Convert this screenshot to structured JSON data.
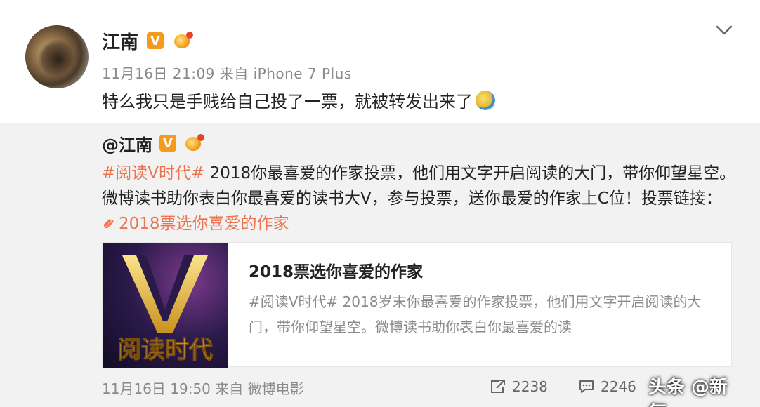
{
  "post": {
    "username": "江南",
    "v_badge": "V",
    "meta": "11月16日 21:09 来自 iPhone 7 Plus",
    "content": "特么我只是手贱给自己投了一票，就被转发出来了"
  },
  "repost": {
    "username": "@江南",
    "v_badge": "V",
    "tag": "#阅读V时代#",
    "text": " 2018你最喜爱的作家投票，他们用文字开启阅读的大门，带你仰望星空。微博读书助你表白你最喜爱的读书大V，参与投票，送你最爱的作家上C位！投票链接：",
    "link_text": "2018票选你喜爱的作家",
    "card": {
      "image_text": "阅读时代",
      "title": "2018票选你喜爱的作家",
      "description": "#阅读V时代# 2018岁末你最喜爱的作家投票，他们用文字开启阅读的大门，带你仰望星空。微博读书助你表白你最喜爱的读"
    },
    "footer": {
      "meta": "11月16日 19:50 来自 微博电影",
      "reposts": "2238",
      "comments": "2246"
    }
  },
  "watermark": "头条 @新氧",
  "colors": {
    "accent": "#eb7350",
    "vbadge": "#f59b1b",
    "repost_bg": "#f2f2f2"
  }
}
